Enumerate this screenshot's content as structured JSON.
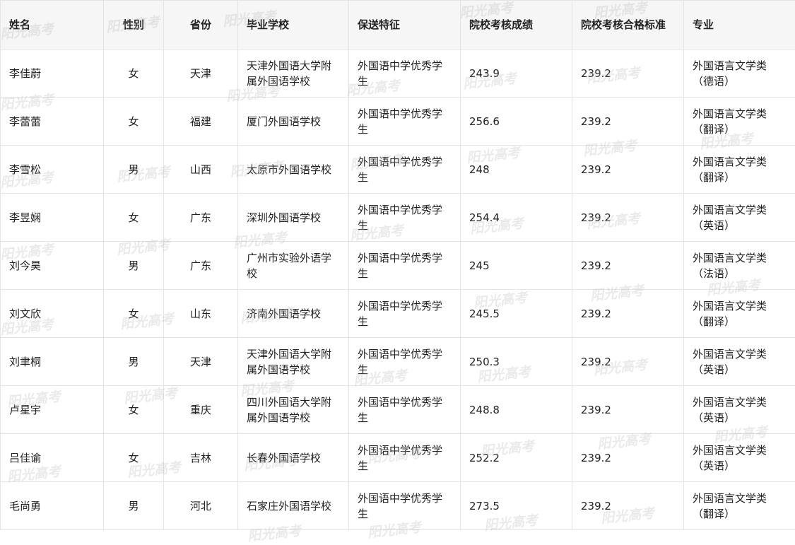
{
  "table": {
    "headers": [
      "姓名",
      "性别",
      "省份",
      "毕业学校",
      "保送特征",
      "院校考核成绩",
      "院校考核合格标准",
      "专业"
    ],
    "rows": [
      [
        "李佳蔚",
        "女",
        "天津",
        "天津外国语大学附属外国语学校",
        "外国语中学优秀学生",
        "243.9",
        "239.2",
        "外国语言文学类（德语）"
      ],
      [
        "李蕾蕾",
        "女",
        "福建",
        "厦门外国语学校",
        "外国语中学优秀学生",
        "256.6",
        "239.2",
        "外国语言文学类（翻译）"
      ],
      [
        "李雪松",
        "男",
        "山西",
        "太原市外国语学校",
        "外国语中学优秀学生",
        "248",
        "239.2",
        "外国语言文学类（翻译）"
      ],
      [
        "李昱娴",
        "女",
        "广东",
        "深圳外国语学校",
        "外国语中学优秀学生",
        "254.4",
        "239.2",
        "外国语言文学类（英语）"
      ],
      [
        "刘今昊",
        "男",
        "广东",
        "广州市实验外语学校",
        "外国语中学优秀学生",
        "245",
        "239.2",
        "外国语言文学类（法语）"
      ],
      [
        "刘文欣",
        "女",
        "山东",
        "济南外国语学校",
        "外国语中学优秀学生",
        "245.5",
        "239.2",
        "外国语言文学类（翻译）"
      ],
      [
        "刘聿桐",
        "男",
        "天津",
        "天津外国语大学附属外国语学校",
        "外国语中学优秀学生",
        "250.3",
        "239.2",
        "外国语言文学类（英语）"
      ],
      [
        "卢星宇",
        "女",
        "重庆",
        "四川外国语大学附属外国语学校",
        "外国语中学优秀学生",
        "248.8",
        "239.2",
        "外国语言文学类（英语）"
      ],
      [
        "吕佳谕",
        "女",
        "吉林",
        "长春外国语学校",
        "外国语中学优秀学生",
        "252.2",
        "239.2",
        "外国语言文学类（英语）"
      ],
      [
        "毛尚勇",
        "男",
        "河北",
        "石家庄外国语学校",
        "外国语中学优秀学生",
        "273.5",
        "239.2",
        "外国语言文学类（翻译）"
      ]
    ]
  },
  "watermark": {
    "text": "阳光高考"
  }
}
